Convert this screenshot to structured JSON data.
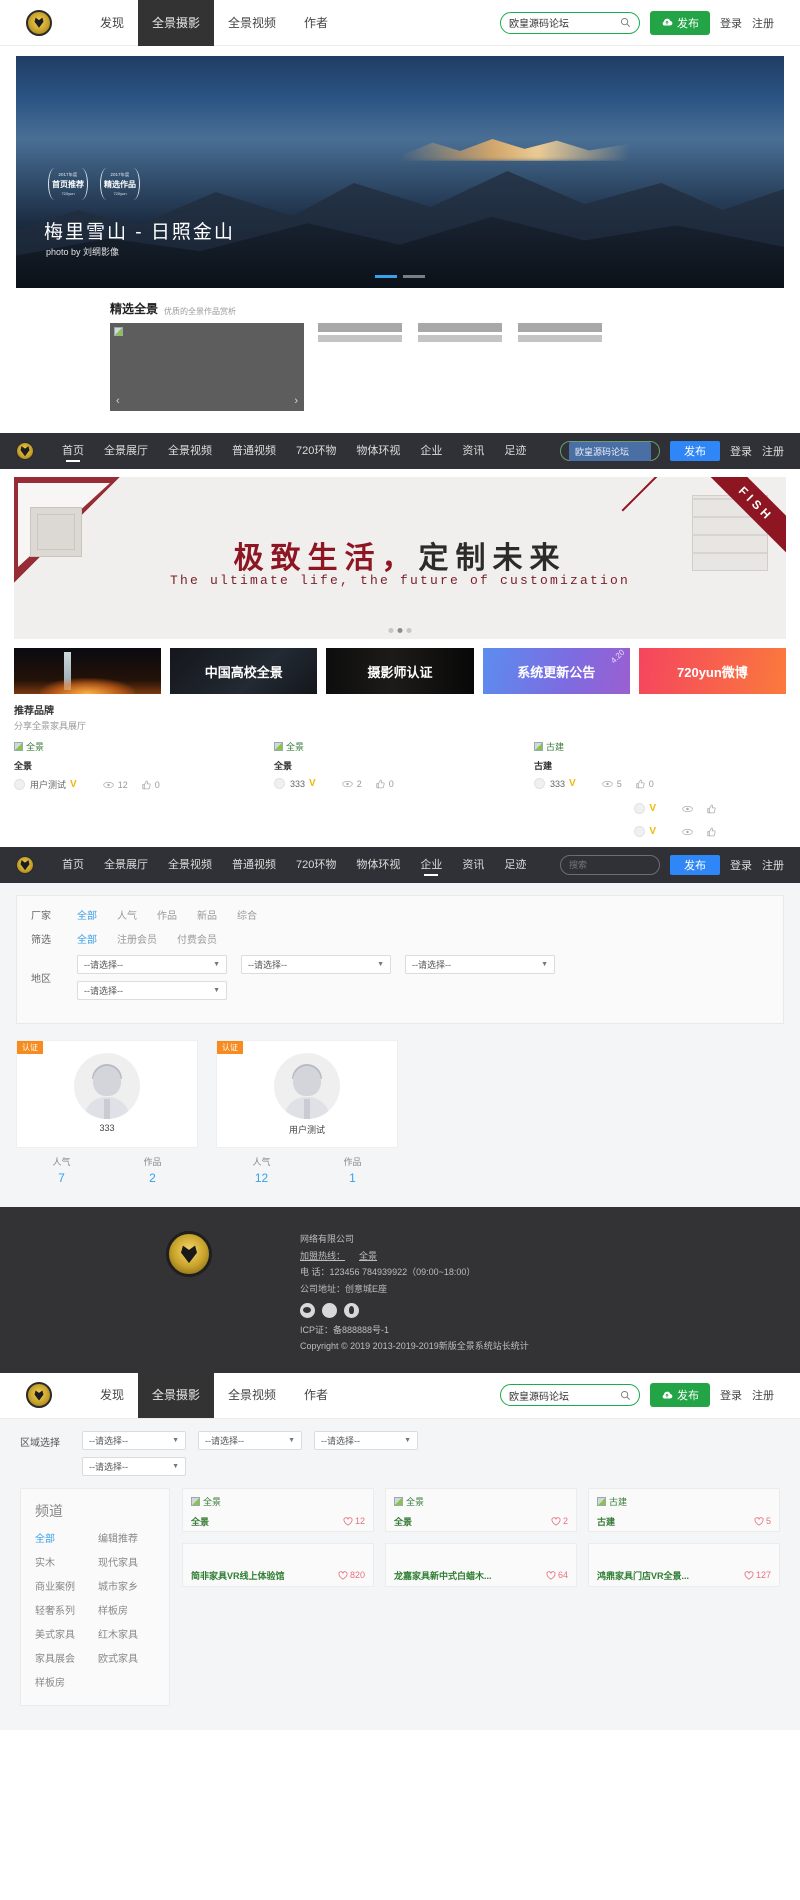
{
  "navTop": {
    "items": [
      {
        "label": "发现",
        "active": false
      },
      {
        "label": "全景摄影",
        "active": true
      },
      {
        "label": "全景视频",
        "active": false
      },
      {
        "label": "作者",
        "active": false
      }
    ],
    "search_value": "欧皇源码论坛",
    "publish_label": "发布",
    "login_label": "登录",
    "register_label": "注册"
  },
  "hero": {
    "title": "梅里雪山 - 日照金山",
    "subtitle": "photo by 刘纲影像",
    "medals": [
      {
        "year": "2017年度",
        "text": "首页推荐",
        "brand": "720yun"
      },
      {
        "year": "2017年度",
        "text": "精选作品",
        "brand": "720yun"
      }
    ]
  },
  "featured": {
    "title": "精选全景",
    "subtitle": "优质的全景作品赏析",
    "prev_icon": "chevron-left-icon",
    "next_icon": "chevron-right-icon",
    "placeholder_alt": "broken-image-icon"
  },
  "navDark": {
    "items": [
      {
        "label": "首页",
        "active": true
      },
      {
        "label": "全景展厅",
        "active": false
      },
      {
        "label": "全景视频",
        "active": false
      },
      {
        "label": "普通视频",
        "active": false
      },
      {
        "label": "720环物",
        "active": false
      },
      {
        "label": "物体环视",
        "active": false
      },
      {
        "label": "企业",
        "active": false
      },
      {
        "label": "资讯",
        "active": false
      },
      {
        "label": "足迹",
        "active": false
      }
    ],
    "search_value": "欧皇源码论坛",
    "publish_label": "发布",
    "login_label": "登录",
    "register_label": "注册"
  },
  "banner2": {
    "title_red": "极致生活，",
    "title_dark": "定制未来",
    "subtitle": "The ultimate life, the future of customization",
    "corner_text": "FISH"
  },
  "tiles": [
    {
      "label": "",
      "kind": "rocket",
      "corner": ""
    },
    {
      "label": "中国高校全景",
      "kind": "univ",
      "corner": ""
    },
    {
      "label": "摄影师认证",
      "kind": "photo",
      "corner": ""
    },
    {
      "label": "系统更新公告",
      "kind": "upd",
      "corner": "4.20"
    },
    {
      "label": "720yun微博",
      "kind": "weibo",
      "corner": ""
    }
  ],
  "brands": {
    "title": "推荐品牌",
    "subtitle": "分享全景家具展厅",
    "items": [
      {
        "thumb_alt": "全景",
        "name": "全景",
        "user": "用户测试",
        "views": "12",
        "likes": "0"
      },
      {
        "thumb_alt": "全景",
        "name": "全景",
        "user": "333",
        "views": "2",
        "likes": "0"
      },
      {
        "thumb_alt": "古建",
        "name": "古建",
        "user": "333",
        "views": "5",
        "likes": "0"
      }
    ],
    "empty_rows": 2
  },
  "navDark2": {
    "items": [
      {
        "label": "首页",
        "active": false
      },
      {
        "label": "全景展厅",
        "active": false
      },
      {
        "label": "全景视频",
        "active": false
      },
      {
        "label": "普通视频",
        "active": false
      },
      {
        "label": "720环物",
        "active": false
      },
      {
        "label": "物体环视",
        "active": false
      },
      {
        "label": "企业",
        "active": true
      },
      {
        "label": "资讯",
        "active": false
      },
      {
        "label": "足迹",
        "active": false
      }
    ],
    "search_placeholder": "搜索",
    "publish_label": "发布",
    "login_label": "登录",
    "register_label": "注册"
  },
  "filters": {
    "rows": [
      {
        "label": "厂家",
        "options": [
          {
            "text": "全部",
            "on": true
          },
          {
            "text": "人气",
            "on": false
          },
          {
            "text": "作品",
            "on": false
          },
          {
            "text": "新品",
            "on": false
          },
          {
            "text": "综合",
            "on": false
          }
        ]
      },
      {
        "label": "筛选",
        "options": [
          {
            "text": "全部",
            "on": true
          },
          {
            "text": "注册会员",
            "on": false
          },
          {
            "text": "付费会员",
            "on": false
          }
        ]
      }
    ],
    "area_label": "地区",
    "area_selects": [
      "--请选择--",
      "--请选择--",
      "--请选择--",
      "--请选择--"
    ],
    "caret_icon": "chevron-down-icon"
  },
  "users": [
    {
      "badge": "认证",
      "name": "333",
      "stats": [
        {
          "key": "人气",
          "value": "7"
        },
        {
          "key": "作品",
          "value": "2"
        }
      ]
    },
    {
      "badge": "认证",
      "name": "用户测试",
      "stats": [
        {
          "key": "人气",
          "value": "12"
        },
        {
          "key": "作品",
          "value": "1"
        }
      ]
    }
  ],
  "footer": {
    "company": "网络有限公司",
    "hotline_label": "加盟热线：",
    "hotline_value": "全景",
    "phone": "电 话：123456 784939922（09:00~18:00）",
    "address": "公司地址：创意城E座",
    "icp": "ICP证：备888888号-1",
    "copyright": "Copyright © 2019 2013-2019-2019新版全景系统站长统计",
    "socials": [
      "wechat-icon",
      "weibo-icon",
      "qq-icon"
    ]
  },
  "navBottom": {
    "items": [
      {
        "label": "发现",
        "active": false
      },
      {
        "label": "全景摄影",
        "active": true
      },
      {
        "label": "全景视频",
        "active": false
      },
      {
        "label": "作者",
        "active": false
      }
    ],
    "search_value": "欧皇源码论坛",
    "publish_label": "发布",
    "login_label": "登录",
    "register_label": "注册"
  },
  "bottom": {
    "area_label": "区域选择",
    "area_selects": [
      "--请选择--",
      "--请选择--",
      "--请选择--",
      "--请选择--"
    ],
    "channel": {
      "title": "频道",
      "items": [
        {
          "text": "全部",
          "on": true
        },
        {
          "text": "编辑推荐",
          "on": false
        },
        {
          "text": "实木",
          "on": false
        },
        {
          "text": "现代家具",
          "on": false
        },
        {
          "text": "商业案例",
          "on": false
        },
        {
          "text": "城市家乡",
          "on": false
        },
        {
          "text": "轻奢系列",
          "on": false
        },
        {
          "text": "样板房",
          "on": false
        },
        {
          "text": "美式家具",
          "on": false
        },
        {
          "text": "红木家具",
          "on": false
        },
        {
          "text": "家具展会",
          "on": false
        },
        {
          "text": "欧式家具",
          "on": false
        },
        {
          "text": "样板房",
          "on": false
        }
      ]
    },
    "cards": [
      {
        "thumb_alt": "全景",
        "title": "全景",
        "likes": "12",
        "has_thumb": true
      },
      {
        "thumb_alt": "全景",
        "title": "全景",
        "likes": "2",
        "has_thumb": true
      },
      {
        "thumb_alt": "古建",
        "title": "古建",
        "likes": "5",
        "has_thumb": true
      },
      {
        "thumb_alt": "",
        "title": "简非家具VR线上体验馆",
        "likes": "820",
        "has_thumb": false
      },
      {
        "thumb_alt": "",
        "title": "龙嘉家具新中式白蜡木...",
        "likes": "64",
        "has_thumb": false
      },
      {
        "thumb_alt": "",
        "title": "鸿鼎家具门店VR全景...",
        "likes": "127",
        "has_thumb": false
      }
    ]
  },
  "colors": {
    "green_accent": "#22a447",
    "blue_accent": "#2f86f6",
    "link_blue": "#3aa0e8",
    "orange_badge": "#f68b1f",
    "dark_nav": "#2f3136",
    "heart_red": "#e8707e",
    "brand_red": "#8d1622"
  }
}
